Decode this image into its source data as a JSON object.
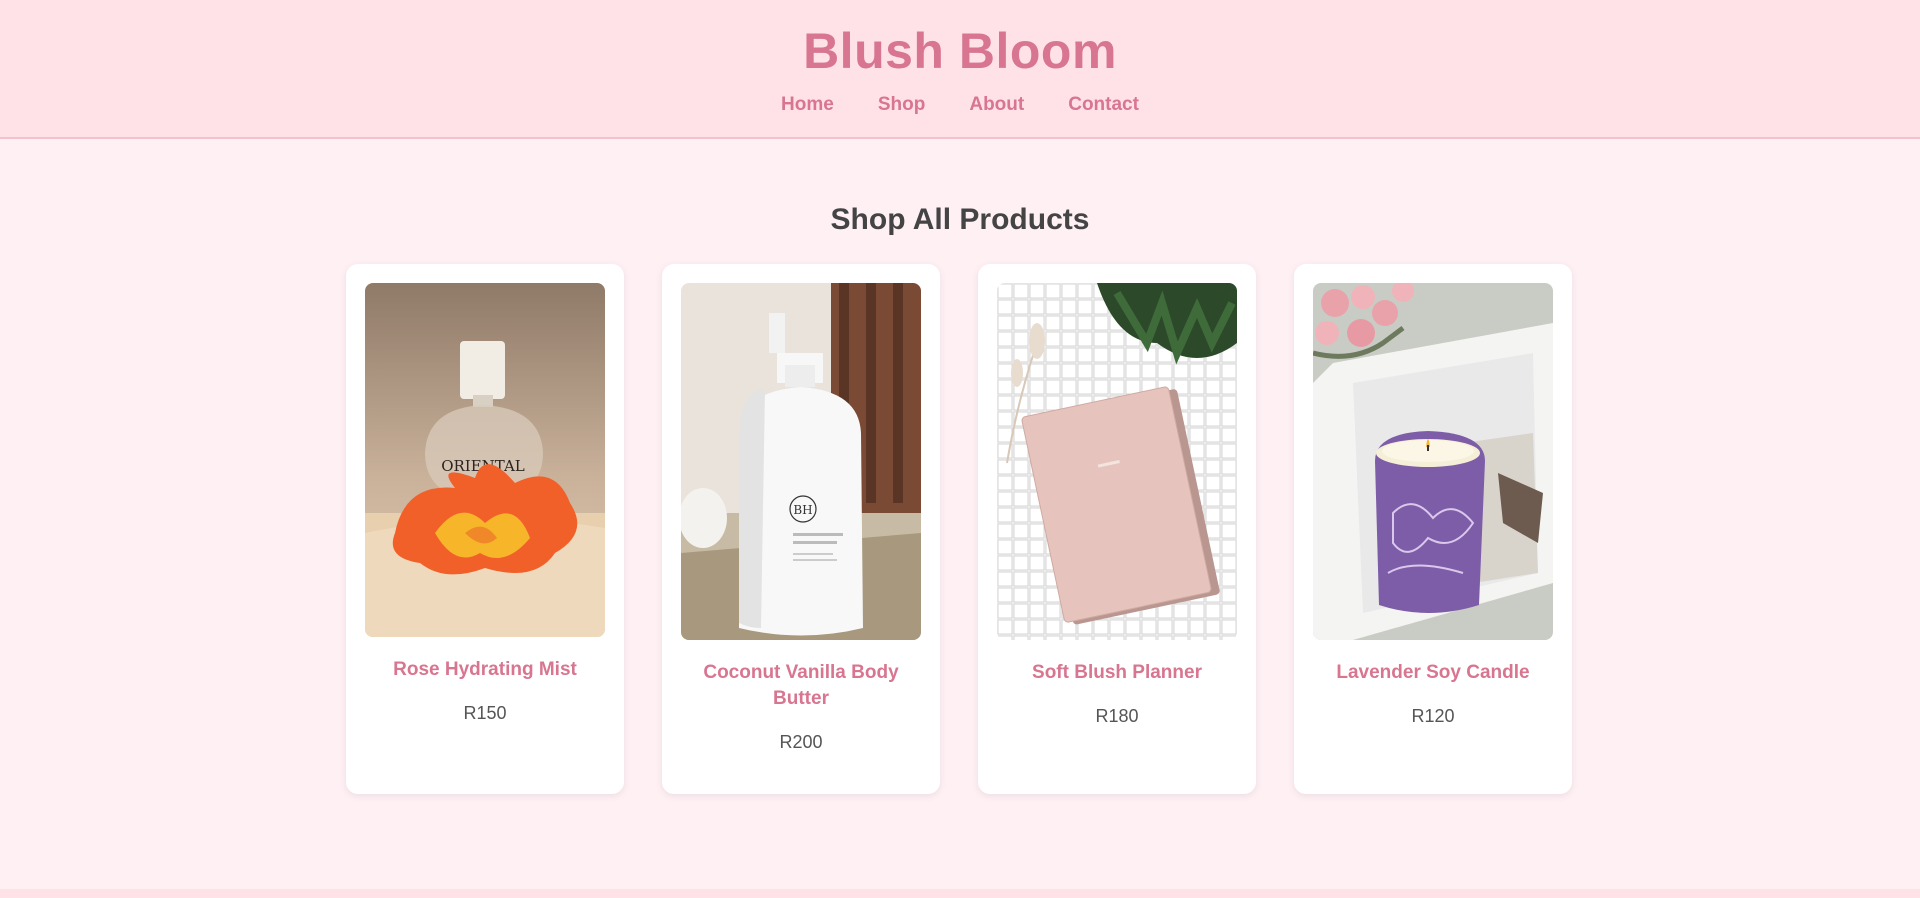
{
  "header": {
    "brand": "Blush Bloom",
    "nav": [
      "Home",
      "Shop",
      "About",
      "Contact"
    ]
  },
  "main": {
    "title": "Shop All Products",
    "products": [
      {
        "name": "Rose Hydrating Mist",
        "price": "R150",
        "image_text": "ORIENTAL"
      },
      {
        "name": "Coconut Vanilla Body Butter",
        "price": "R200",
        "image_text": "BH"
      },
      {
        "name": "Soft Blush Planner",
        "price": "R180",
        "image_text": ""
      },
      {
        "name": "Lavender Soy Candle",
        "price": "R120",
        "image_text": ""
      }
    ]
  },
  "colors": {
    "accent": "#d87590",
    "header_bg": "#ffe2e8",
    "page_bg": "#fff0f4"
  }
}
